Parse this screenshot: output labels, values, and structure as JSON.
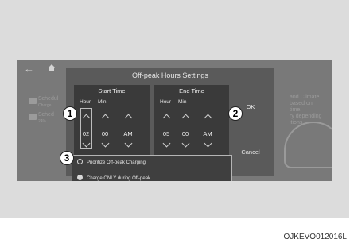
{
  "screen": {
    "background_items": [
      {
        "title": "Schedul",
        "sub": "Charge"
      },
      {
        "title": "Sched",
        "sub": "24%"
      }
    ],
    "background_right_text": [
      "and Climate",
      "based on",
      "time.",
      "ry depending",
      "itions"
    ],
    "dialog": {
      "title": "Off-peak Hours Settings",
      "start": {
        "title": "Start Time",
        "hour_label": "Hour",
        "min_label": "Min",
        "hour": "02",
        "min": "00",
        "ampm": "AM"
      },
      "end": {
        "title": "End Time",
        "hour_label": "Hour",
        "min_label": "Min",
        "hour": "05",
        "min": "00",
        "ampm": "AM"
      },
      "ok_label": "OK",
      "cancel_label": "Cancel",
      "options": [
        {
          "label": "Prioritize Off-peak Charging",
          "selected": false
        },
        {
          "label": "Charge ONLY during Off-peak",
          "selected": true
        }
      ]
    }
  },
  "callouts": [
    "1",
    "2",
    "3"
  ],
  "caption": "OJKEVO012016L"
}
